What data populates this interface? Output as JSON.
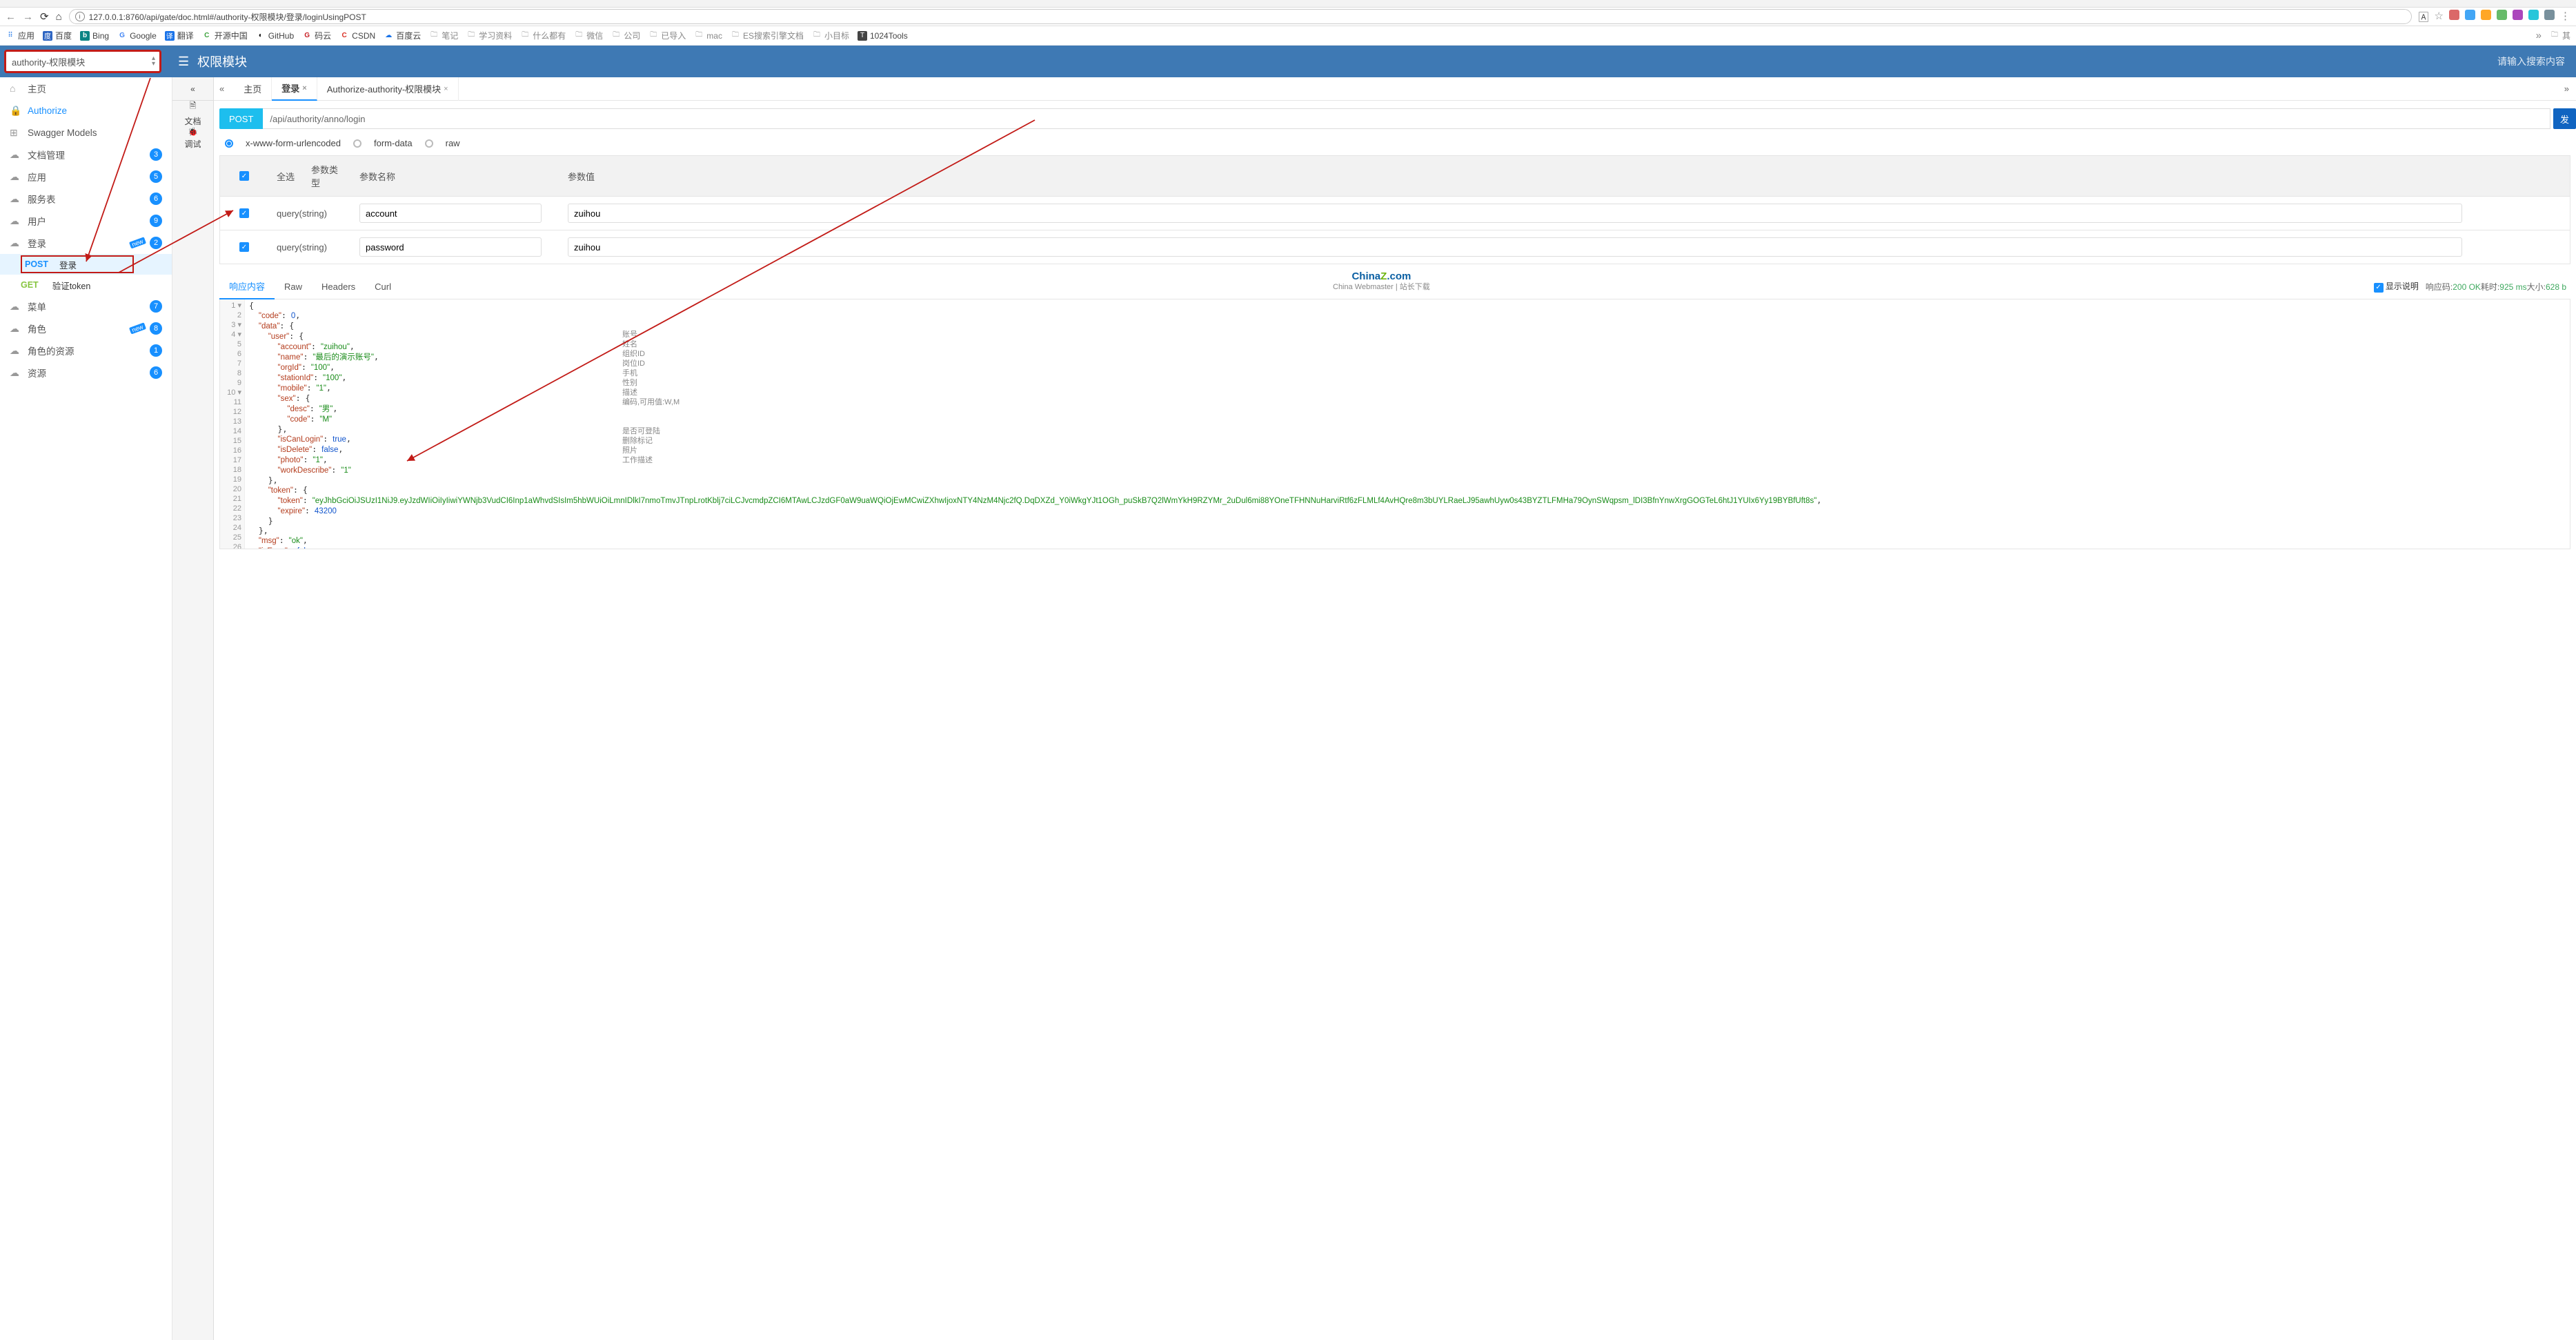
{
  "browser": {
    "url": "127.0.0.1:8760/api/gate/doc.html#/authority-权限模块/登录/loginUsingPOST",
    "bookmarks": [
      "应用",
      "百度",
      "Bing",
      "Google",
      "翻译",
      "开源中国",
      "GitHub",
      "码云",
      "CSDN",
      "百度云",
      "笔记",
      "学习资料",
      "什么都有",
      "微信",
      "公司",
      "已导入",
      "mac",
      "ES搜索引擎文档",
      "小目标",
      "1024Tools"
    ],
    "overflow": "其"
  },
  "header": {
    "module_select": "authority-权限模块",
    "title": "权限模块",
    "search_ph": "请输入搜索内容"
  },
  "sidebar": [
    {
      "icon": "⌂",
      "label": "主页"
    },
    {
      "icon": "🔒",
      "label": "Authorize",
      "hl": true
    },
    {
      "icon": "⊞",
      "label": "Swagger Models"
    },
    {
      "icon": "☁",
      "label": "文档管理",
      "badge": "3"
    },
    {
      "icon": "☁",
      "label": "应用",
      "badge": "5"
    },
    {
      "icon": "☁",
      "label": "服务表",
      "badge": "6"
    },
    {
      "icon": "☁",
      "label": "用户",
      "badge": "9"
    },
    {
      "icon": "☁",
      "label": "登录",
      "badge": "2",
      "new": true,
      "expanded": true,
      "children": [
        {
          "method": "POST",
          "label": "登录",
          "active": true
        },
        {
          "method": "GET",
          "label": "验证token"
        }
      ]
    },
    {
      "icon": "☁",
      "label": "菜单",
      "badge": "7"
    },
    {
      "icon": "☁",
      "label": "角色",
      "badge": "8",
      "new": true
    },
    {
      "icon": "☁",
      "label": "角色的资源",
      "badge": "1"
    },
    {
      "icon": "☁",
      "label": "资源",
      "badge": "6"
    }
  ],
  "rail": {
    "doc": "文档",
    "debug": "调试"
  },
  "tabs": {
    "home": "主页",
    "t1": "登录",
    "t2": "Authorize-authority-权限模块"
  },
  "api": {
    "method": "POST",
    "path": "/api/authority/anno/login",
    "send": "发"
  },
  "bodytypes": {
    "xform": "x-www-form-urlencoded",
    "formdata": "form-data",
    "raw": "raw"
  },
  "paramTable": {
    "selectAll": "全选",
    "colType": "参数类型",
    "colName": "参数名称",
    "colVal": "参数值",
    "rows": [
      {
        "type": "query(string)",
        "name": "account",
        "val": "zuihou"
      },
      {
        "type": "query(string)",
        "name": "password",
        "val": "zuihou"
      }
    ]
  },
  "respTabs": {
    "body": "响应内容",
    "raw": "Raw",
    "headers": "Headers",
    "curl": "Curl"
  },
  "respMeta": {
    "showDesc": "显示说明",
    "codeLbl": "响应码:",
    "code": "200 OK",
    "timeLbl": "耗时:",
    "time": "925 ms",
    "sizeLbl": "大小:",
    "size": "628 b"
  },
  "watermark": {
    "brand": "China",
    "z": "Z",
    "dom": ".com",
    "sub": "China Webmaster | 站长下载"
  },
  "code": {
    "token": "eyJhbGciOiJSUzI1NiJ9.eyJzdWIiOiIyIiwiYWNjb3VudCI6Inp1aWhvdSIsIm5hbWUiOiLmnIDlkI7nmoTmvJTnpLrotKblj7ciLCJvcmdpZCI6MTAwLCJzdGF0aW9uaWQiOjEwMCwiZXhwIjoxNTY4NzM4Njc2fQ.DqDXZd_Y0iWkgYJt1OGh_puSkB7Q2lWmYkH9RZYMr_2uDul6mi88YOneTFHNNuHarviRtf6zFLMLf4AvHQre8m3bUYLRaeLJ95awhUyw0s43BYZTLFMHa79OynSWqpsm_lDI3BfnYnwXrgGOGTeL6htJ1YUIx6Yy19BYBfUft8s",
    "annotations": [
      "",
      "",
      "",
      "账号",
      "姓名",
      "组织ID",
      "岗位ID",
      "手机",
      "性别",
      "描述",
      "编码,可用值:W,M",
      "",
      "",
      "是否可登陆",
      "删除标记",
      "照片",
      "工作描述"
    ]
  }
}
